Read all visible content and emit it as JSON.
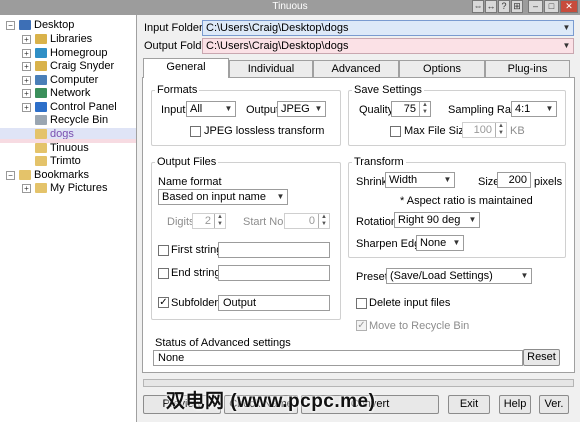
{
  "window": {
    "title": "Tinuous"
  },
  "tree": {
    "items": [
      {
        "label": "Desktop",
        "level": 0,
        "expander": "−",
        "icon": "desktop-icon"
      },
      {
        "label": "Libraries",
        "level": 1,
        "expander": "+",
        "icon": "libraries-icon"
      },
      {
        "label": "Homegroup",
        "level": 1,
        "expander": "+",
        "icon": "homegroup-icon"
      },
      {
        "label": "Craig Snyder",
        "level": 1,
        "expander": "+",
        "icon": "user-folder-icon"
      },
      {
        "label": "Computer",
        "level": 1,
        "expander": "+",
        "icon": "computer-icon"
      },
      {
        "label": "Network",
        "level": 1,
        "expander": "+",
        "icon": "network-icon"
      },
      {
        "label": "Control Panel",
        "level": 1,
        "expander": "+",
        "icon": "control-panel-icon"
      },
      {
        "label": "Recycle Bin",
        "level": 1,
        "expander": "",
        "icon": "recycle-bin-icon"
      },
      {
        "label": "dogs",
        "level": 1,
        "expander": "",
        "icon": "folder-icon",
        "selected": true
      },
      {
        "label": "Tinuous",
        "level": 1,
        "expander": "",
        "icon": "folder-icon"
      },
      {
        "label": "Trimto",
        "level": 1,
        "expander": "",
        "icon": "folder-icon"
      },
      {
        "label": "Bookmarks",
        "level": 0,
        "expander": "−",
        "icon": "bookmark-folder-icon"
      },
      {
        "label": "My Pictures",
        "level": 1,
        "expander": "+",
        "icon": "folder-icon"
      }
    ]
  },
  "folders": {
    "input_label": "Input Folder",
    "input_value": "C:\\Users\\Craig\\Desktop\\dogs",
    "output_label": "Output Folder",
    "output_value": "C:\\Users\\Craig\\Desktop\\dogs"
  },
  "tabs": [
    "General",
    "Individual",
    "Advanced",
    "Options",
    "Plug-ins"
  ],
  "formats": {
    "title": "Formats",
    "input_label": "Input",
    "input_value": "All",
    "output_label": "Output",
    "output_value": "JPEG",
    "lossless_label": "JPEG lossless transform"
  },
  "save": {
    "title": "Save Settings",
    "quality_label": "Quality",
    "quality_value": "75",
    "sampling_label": "Sampling Ratio",
    "sampling_value": "4:1",
    "maxsize_label": "Max File Size",
    "maxsize_value": "100",
    "maxsize_unit": "KB"
  },
  "output_files": {
    "title": "Output Files",
    "name_format_label": "Name format",
    "name_format_value": "Based on input name",
    "digits_label": "Digits",
    "digits_value": "2",
    "start_label": "Start No.",
    "start_value": "0",
    "first_string_label": "First string",
    "first_string_value": "",
    "end_string_label": "End string",
    "end_string_value": "",
    "subfolder_label": "Subfolder",
    "subfolder_value": "Output",
    "subfolder_checked": "✓"
  },
  "transform": {
    "title": "Transform",
    "shrink_label": "Shrink",
    "shrink_value": "Width",
    "size_label": "Size",
    "size_value": "200",
    "size_unit": "pixels",
    "aspect_note": "* Aspect ratio is maintained",
    "rotation_label": "Rotation",
    "rotation_value": "Right 90 deg",
    "sharpen_label": "Sharpen Edge",
    "sharpen_value": "None"
  },
  "preset": {
    "label": "Preset",
    "value": "(Save/Load Settings)",
    "delete_label": "Delete input files",
    "recycle_label": "Move to Recycle Bin",
    "recycle_checked": "✓"
  },
  "status": {
    "label": "Status of Advanced settings",
    "value": "None",
    "reset_label": "Reset"
  },
  "buttons": {
    "preview": "Preview",
    "check_name": "Check Name",
    "convert": "Convert",
    "exit": "Exit",
    "help": "Help",
    "ver": "Ver."
  },
  "watermark": "双电网 (www.pcpc.me)"
}
